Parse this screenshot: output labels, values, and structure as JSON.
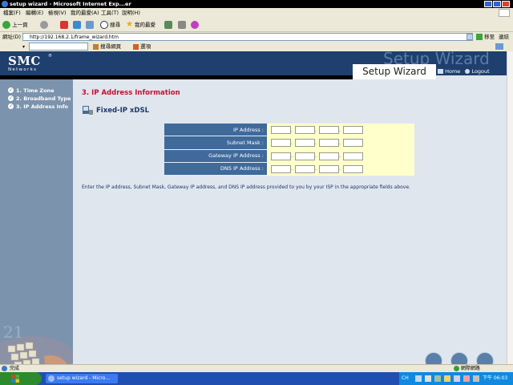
{
  "window": {
    "title": "setup wizard - Microsoft Internet Exp...er"
  },
  "menu": [
    "檔案(F)",
    "編輯(E)",
    "檢視(V)",
    "我的最愛(A)",
    "工具(T)",
    "說明(H)"
  ],
  "toolbar": {
    "back_label": "上一頁",
    "search_label": "搜尋",
    "favorites_label": "我的最愛"
  },
  "address": {
    "label": "網址(D)",
    "url": "http://192.168.2.1/frame_wizard.htm",
    "go_label": "移至",
    "links_label": "連結"
  },
  "linkbar": {
    "search_web_label": "搜尋網頁",
    "options_label": "選項"
  },
  "header": {
    "logo": "SMC",
    "logo_sub": "Networks",
    "watermark": "Setup Wizard",
    "title": "Setup Wizard",
    "home_label": "Home",
    "logout_label": "Logout"
  },
  "sidebar": {
    "steps": [
      {
        "label": "1. Time Zone"
      },
      {
        "label": "2. Broadband Type"
      },
      {
        "label": "3. IP Address Info"
      }
    ],
    "art_number": "21"
  },
  "content": {
    "section_title": "3. IP Address Information",
    "connection_title": "Fixed-IP xDSL",
    "fields": [
      {
        "label": "IP Address :"
      },
      {
        "label": "Subnet Mask :"
      },
      {
        "label": "Gateway IP Address :"
      },
      {
        "label": "DNS IP Address :"
      }
    ],
    "instructions": "Enter the IP address, Subnet Mask, Gateway IP address, and DNS IP address provided to you by your ISP in the appropriate fields above."
  },
  "statusbar": {
    "left": "完成",
    "zone": "網際網路"
  },
  "taskbar": {
    "task_label": "setup wizard - Micro...",
    "clock": "下午 06:03",
    "lang": "CH"
  },
  "colors": {
    "header_bg": "#1f3f6e",
    "sidebar_bg": "#7c93ad",
    "content_bg": "#dfe6ee",
    "label_cell_bg": "#3f6a9a",
    "input_cell_bg": "#ffffcc",
    "section_title": "#c8102e"
  }
}
